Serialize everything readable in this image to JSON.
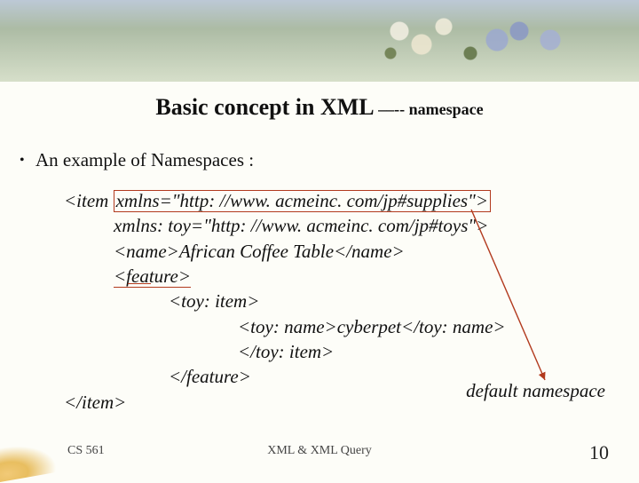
{
  "title": {
    "main": "Basic concept in XML",
    "dash": " ––-- ",
    "sub": "namespace"
  },
  "bullet": "An example of Namespaces :",
  "xml": {
    "l1a": "<item ",
    "l1b": "xmlns=\"http: //www. acmeinc. com/jp#supplies\">",
    "l2": "xmlns: toy=\"http: //www. acmeinc. com/jp#toys\">",
    "l3": "<name>African Coffee Table</name>",
    "l4": "<feature>",
    "l5": "<toy: item>",
    "l6": "<toy: name>cyberpet</toy: name>",
    "l7": "</toy: item>",
    "l8": "</feature>",
    "l9": "</item>"
  },
  "annotation": "default namespace",
  "footer": {
    "left": "CS 561",
    "center": "XML & XML Query",
    "page": "10"
  }
}
